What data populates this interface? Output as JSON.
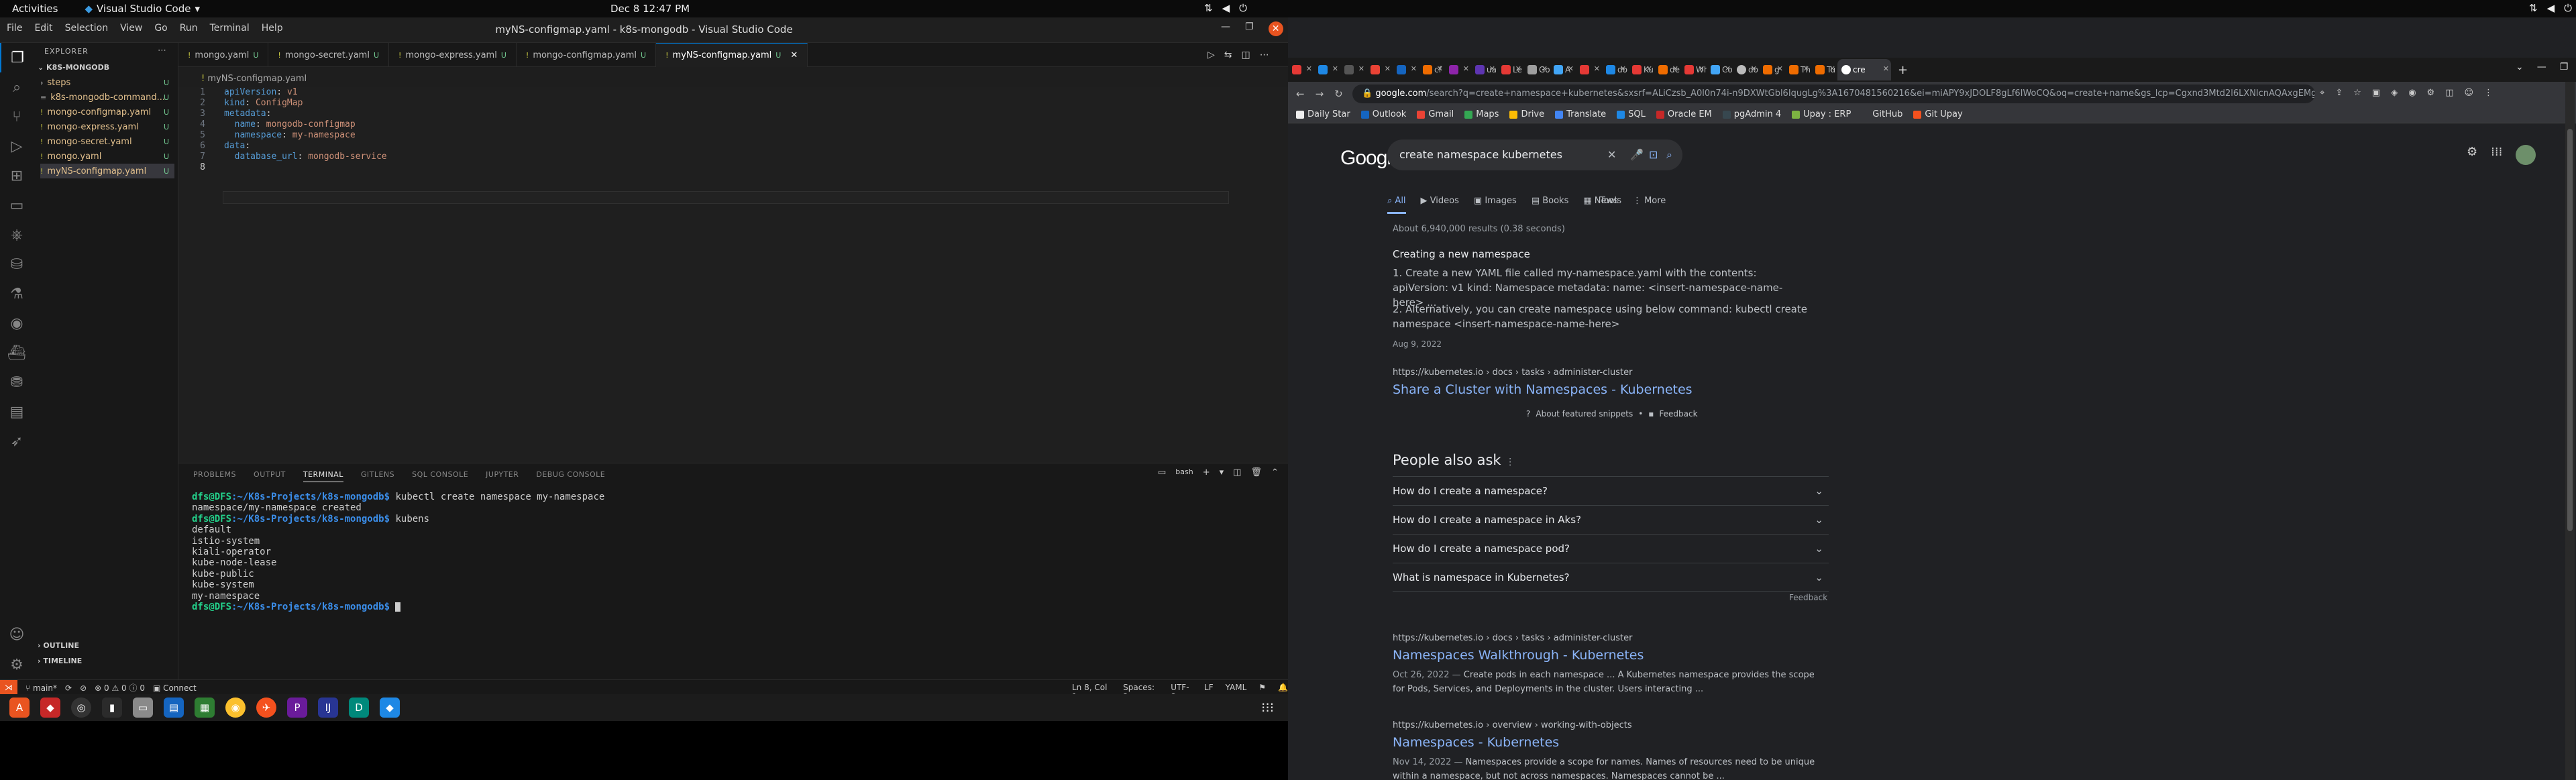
{
  "topbar": {
    "activities": "Activities",
    "app_name": "Visual Studio Code",
    "clock": "Dec 8  12:47 PM"
  },
  "vscode": {
    "window_title": "myNS-configmap.yaml - k8s-mongodb - Visual Studio Code",
    "menu": [
      "File",
      "Edit",
      "Selection",
      "View",
      "Go",
      "Run",
      "Terminal",
      "Help"
    ],
    "explorer_title": "EXPLORER",
    "project": "K8S-MONGODB",
    "files": [
      {
        "name": "steps",
        "status": "U"
      },
      {
        "name": "k8s-mongodb-command...",
        "status": "U"
      },
      {
        "name": "mongo-configmap.yaml",
        "status": "U"
      },
      {
        "name": "mongo-express.yaml",
        "status": "U"
      },
      {
        "name": "mongo-secret.yaml",
        "status": "U"
      },
      {
        "name": "mongo.yaml",
        "status": "U"
      },
      {
        "name": "myNS-configmap.yaml",
        "status": "U"
      }
    ],
    "outline": "OUTLINE",
    "timeline": "TIMELINE",
    "tabs": [
      {
        "label": "mongo.yaml",
        "mod": "U"
      },
      {
        "label": "mongo-secret.yaml",
        "mod": "U"
      },
      {
        "label": "mongo-express.yaml",
        "mod": "U"
      },
      {
        "label": "mongo-configmap.yaml",
        "mod": "U"
      },
      {
        "label": "myNS-configmap.yaml",
        "mod": "U"
      }
    ],
    "breadcrumb": "myNS-configmap.yaml",
    "code": [
      {
        "n": "1",
        "key": "apiVersion",
        "val": "v1"
      },
      {
        "n": "2",
        "key": "kind",
        "val": "ConfigMap"
      },
      {
        "n": "3",
        "key": "metadata",
        "val": ""
      },
      {
        "n": "4",
        "key": "  name",
        "val": "mongodb-configmap"
      },
      {
        "n": "5",
        "key": "  namespace",
        "val": "my-namespace"
      },
      {
        "n": "6",
        "key": "data",
        "val": ""
      },
      {
        "n": "7",
        "key": "  database_url",
        "val": "mongodb-service"
      },
      {
        "n": "8",
        "key": "",
        "val": ""
      }
    ],
    "panel_tabs": [
      "PROBLEMS",
      "OUTPUT",
      "TERMINAL",
      "GITLENS",
      "SQL CONSOLE",
      "JUPYTER",
      "DEBUG CONSOLE"
    ],
    "terminal_shell": "bash",
    "terminal": {
      "prompt_user": "dfs@DFS",
      "prompt_path": ":~/K8s-Projects/k8s-mongodb$",
      "cmd1": " kubectl create namespace my-namespace",
      "out1": [
        "namespace/my-namespace created"
      ],
      "cmd2": " kubens",
      "out2": [
        "default",
        "istio-system",
        "kiali-operator",
        "kube-node-lease",
        "kube-public",
        "kube-system",
        "my-namespace"
      ]
    },
    "status": {
      "branch": "main*",
      "problems": "0",
      "warnings": "0",
      "info": "0",
      "connect": "Connect",
      "position": "Ln 8, Col 1",
      "spaces": "Spaces: 2",
      "encoding": "UTF-8",
      "eol": "LF",
      "language": "YAML"
    }
  },
  "chrome": {
    "active_tab": "cre",
    "tabs": [
      "",
      "",
      "",
      "",
      "",
      "cf",
      "",
      "ua",
      "Le",
      "Go",
      "A",
      "",
      "do",
      "Ku",
      "de",
      "Wh",
      "Co",
      "do",
      "g",
      "Th",
      "Tu"
    ],
    "url_domain": "google.com",
    "url_path": "/search?q=create+namespace+kubernetes&sxsrf=ALiCzsb_A0l0n74i-n9DXWtGbl6IqugLg%3A1670481560216&ei=miAPY9xJDOLF8gLf6IWoCQ&oq=create+name&gs_lcp=Cgxnd3Mtd2l6LXNlcnAQAxgEMgUIABCABD...",
    "bookmarks": [
      "Daily Star",
      "Outlook",
      "Gmail",
      "Maps",
      "Drive",
      "Translate",
      "SQL",
      "Oracle EM",
      "pgAdmin 4",
      "Upay : ERP",
      "GitHub",
      "Git Upay"
    ]
  },
  "google": {
    "query": "create namespace kubernetes",
    "tabs": [
      "All",
      "Videos",
      "Images",
      "Books",
      "News",
      "More"
    ],
    "tools": "Tools",
    "result_count": "About 6,940,000 results (0.38 seconds)",
    "snippet_title": "Creating a new namespace",
    "snippet_items": [
      "Create a new YAML file called my-namespace.yaml with the contents: apiVersion: v1 kind: Namespace metadata: name: <insert-namespace-name-here> ...",
      "Alternatively, you can create namespace using below command: kubectl create namespace <insert-namespace-name-here>"
    ],
    "snippet_date": "Aug 9, 2022",
    "snippet_source": "https://kubernetes.io › docs › tasks › administer-cluster",
    "snippet_link": "Share a Cluster with Namespaces - Kubernetes",
    "about_snippets": "About featured snippets",
    "feedback": "Feedback",
    "paa_title": "People also ask",
    "paa": [
      "How do I create a namespace?",
      "How do I create a namespace in Aks?",
      "How do I create a namespace pod?",
      "What is namespace in Kubernetes?"
    ],
    "results": [
      {
        "url": "https://kubernetes.io › docs › tasks › administer-cluster",
        "title": "Namespaces Walkthrough - Kubernetes",
        "date": "Oct 26, 2022 — ",
        "desc": "Create pods in each namespace ... A Kubernetes namespace provides the scope for Pods, Services, and Deployments in the cluster. Users interacting ..."
      },
      {
        "url": "https://kubernetes.io › overview › working-with-objects",
        "title": "Namespaces - Kubernetes",
        "date": "Nov 14, 2022 — ",
        "desc": "Namespaces provide a scope for names. Names of resources need to be unique within a namespace, but not across namespaces. Namespaces cannot be ..."
      }
    ]
  },
  "colors": {
    "vscode_bg": "#1e1e1e",
    "ubuntu_orange": "#e95420",
    "google_link": "#8ab4f8",
    "chrome_bg": "#202124"
  }
}
